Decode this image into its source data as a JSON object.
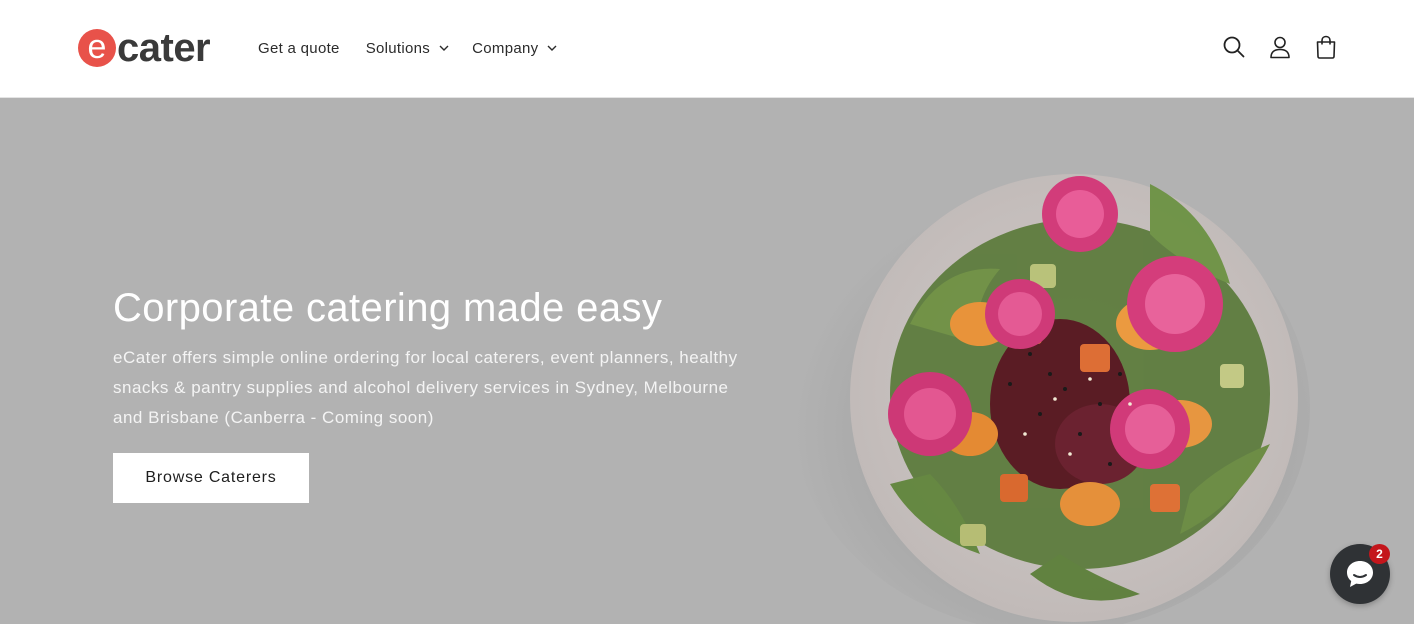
{
  "brand": {
    "logo_letter": "e",
    "logo_rest": "cater",
    "accent_color": "#e8524a"
  },
  "nav": {
    "items": [
      {
        "label": "Get a quote",
        "has_dropdown": false
      },
      {
        "label": "Solutions",
        "has_dropdown": true
      },
      {
        "label": "Company",
        "has_dropdown": true
      }
    ]
  },
  "header_icons": [
    "search-icon",
    "account-icon",
    "cart-icon"
  ],
  "hero": {
    "title": "Corporate catering made easy",
    "description": "eCater offers simple online ordering for local caterers, event planners, healthy snacks & pantry supplies and alcohol delivery services in Sydney, Melbourne and Brisbane (Canberra - Coming soon)",
    "button_label": "Browse Caterers",
    "image": "salad-bowl-image"
  },
  "chat": {
    "icon": "chat-icon",
    "badge_count": "2",
    "badge_color": "#c4161c"
  }
}
